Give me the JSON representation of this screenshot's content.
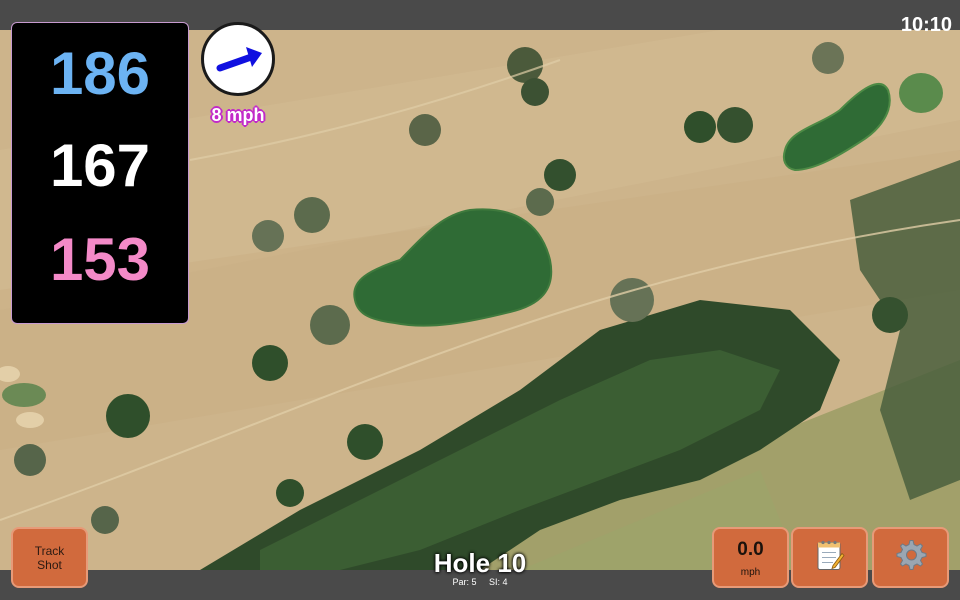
{
  "status": {
    "clock": "10:10"
  },
  "distances": {
    "back": "186",
    "middle": "167",
    "front": "153"
  },
  "wind": {
    "speed_label": "8 mph",
    "icon": "wind-arrow-icon"
  },
  "hole": {
    "title": "Hole 10",
    "par": "Par: 5",
    "stroke_index": "SI: 4"
  },
  "buttons": {
    "track_line1": "Track",
    "track_line2": "Shot",
    "speed_value": "0.0",
    "speed_unit": "mph",
    "notes_icon": "notepad-icon",
    "settings_icon": "gear-icon"
  },
  "colors": {
    "back": "#6cb3f3",
    "middle": "#ffffff",
    "front": "#f48ac8",
    "button": "#d16a3d",
    "wind_label_outline": "#c22ac9",
    "water": "#2f6b35",
    "fairway": "#cdb48b"
  }
}
